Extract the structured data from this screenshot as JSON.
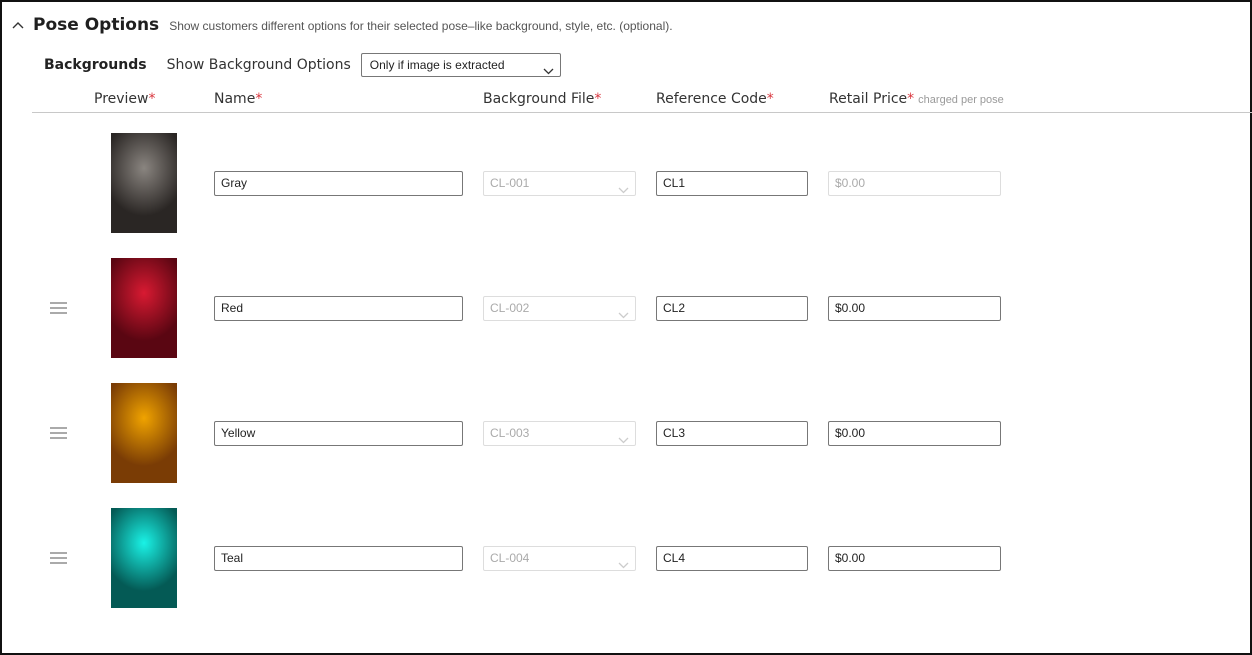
{
  "section": {
    "title": "Pose Options",
    "description": "Show customers different options for their selected pose–like background, style, etc. (optional)."
  },
  "backgrounds": {
    "label": "Backgrounds",
    "show_label": "Show Background Options",
    "show_selected": "Only if image is extracted"
  },
  "columns": {
    "preview": "Preview",
    "name": "Name",
    "file": "Background File",
    "ref": "Reference Code",
    "price": "Retail Price",
    "price_hint": "charged per pose",
    "required_mark": "*"
  },
  "rows": [
    {
      "name": "Gray",
      "file": "CL-001",
      "ref": "CL1",
      "price": "$0.00",
      "price_disabled": true,
      "draggable": false,
      "color_center": "#8a8580",
      "color_edge": "#2a2624"
    },
    {
      "name": "Red",
      "file": "CL-002",
      "ref": "CL2",
      "price": "$0.00",
      "price_disabled": false,
      "draggable": true,
      "color_center": "#d81a32",
      "color_edge": "#5a0612"
    },
    {
      "name": "Yellow",
      "file": "CL-003",
      "ref": "CL3",
      "price": "$0.00",
      "price_disabled": false,
      "draggable": true,
      "color_center": "#f0a300",
      "color_edge": "#7a3c05"
    },
    {
      "name": "Teal",
      "file": "CL-004",
      "ref": "CL4",
      "price": "$0.00",
      "price_disabled": false,
      "draggable": true,
      "color_center": "#1af2e6",
      "color_edge": "#045a55"
    }
  ]
}
